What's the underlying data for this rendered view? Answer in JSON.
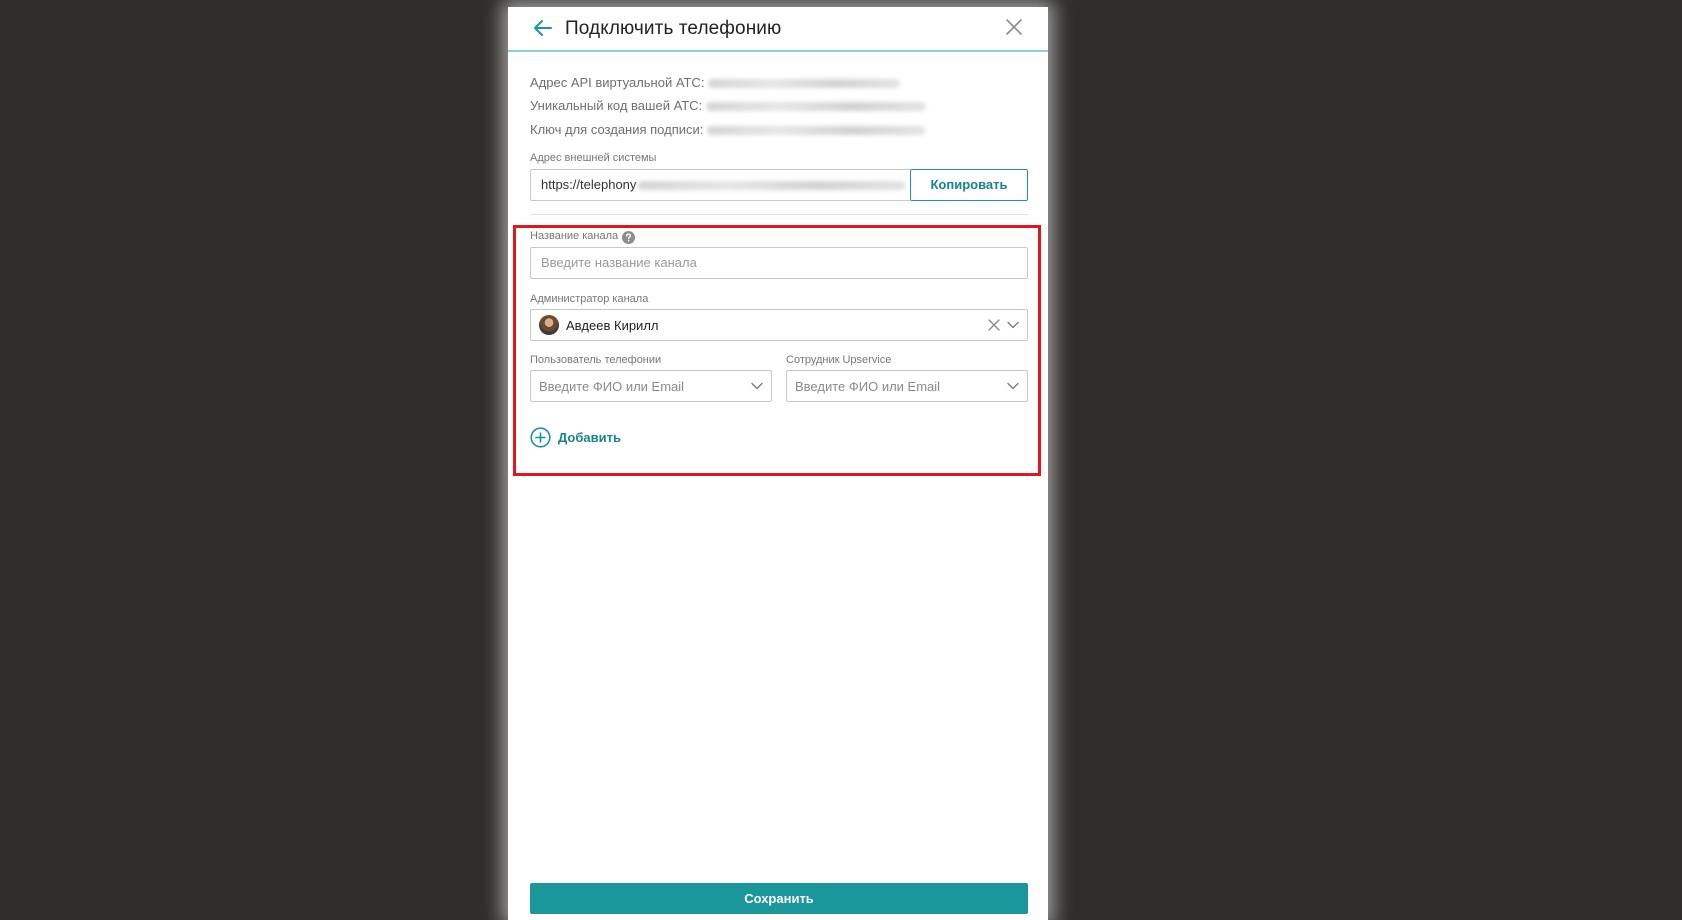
{
  "dialog": {
    "title": "Подключить телефонию"
  },
  "info": {
    "api_address_label": "Адрес API виртуальной АТС:",
    "unique_code_label": "Уникальный код вашей АТС:",
    "signature_key_label": "Ключ для создания подписи:"
  },
  "external_system": {
    "label": "Адрес внешней системы",
    "url_value": "https://telephony",
    "copy_label": "Копировать"
  },
  "channel": {
    "name_label": "Название канала",
    "name_placeholder": "Введите название канала",
    "admin_label": "Администратор канала",
    "admin_value": "Авдеев Кирилл",
    "telephony_user_label": "Пользователь телефонии",
    "telephony_user_placeholder": "Введите ФИО или Email",
    "employee_label": "Сотрудник Upservice",
    "employee_placeholder": "Введите ФИО или Email",
    "add_label": "Добавить"
  },
  "footer": {
    "save_label": "Сохранить"
  },
  "colors": {
    "accent": "#1a979b",
    "highlight": "#e3161d",
    "backdrop": "#2f2d2b"
  },
  "icons": [
    "arrow-left-icon",
    "close-icon",
    "help-icon",
    "chevron-down-icon",
    "clear-icon",
    "plus-circle-icon"
  ]
}
